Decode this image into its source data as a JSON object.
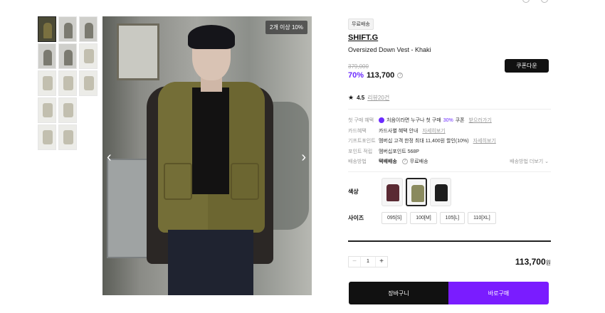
{
  "product": {
    "badge_image": "2개 이상 10%",
    "free_shipping_badge": "무료배송",
    "brand": "SHIFT.G",
    "name": "Oversized Down Vest - Khaki",
    "original_price": "379,000",
    "discount": "70%",
    "price": "113,700",
    "coupon_button": "쿠폰다운",
    "rating": "4.5",
    "review_link": "리뷰20건"
  },
  "benefits": [
    {
      "label": "첫 구매 혜택",
      "text": "처음이라면 누구나 첫 구매",
      "highlight": "30%",
      "suffix": "쿠폰",
      "link": "받으러가기"
    },
    {
      "label": "카드혜택",
      "text": "카드사별 혜택 안내",
      "link": "자세히보기"
    },
    {
      "label": "기프트포인트",
      "text": "멤버십 고객 한정 최대 11,400원 할인(10%)",
      "link": "자세히보기"
    },
    {
      "label": "포인트 적립",
      "text": "멤버십포인트 568P"
    },
    {
      "label": "배송방법",
      "text": "택배배송",
      "suffix": "무료배송",
      "more": "배송방법 더보기"
    }
  ],
  "options": {
    "color_label": "색상",
    "colors": [
      {
        "name": "burgundy",
        "hex": "#5a2a33"
      },
      {
        "name": "khaki",
        "hex": "#8a8a5e"
      },
      {
        "name": "black",
        "hex": "#1c1c1c"
      }
    ],
    "size_label": "사이즈",
    "sizes": [
      "095[S]",
      "100[M]",
      "105[L]",
      "110[XL]"
    ]
  },
  "order": {
    "quantity": "1",
    "minus": "−",
    "plus": "+",
    "total": "113,700",
    "currency": "원",
    "cart_button": "장바구니",
    "buy_button": "바로구매"
  }
}
